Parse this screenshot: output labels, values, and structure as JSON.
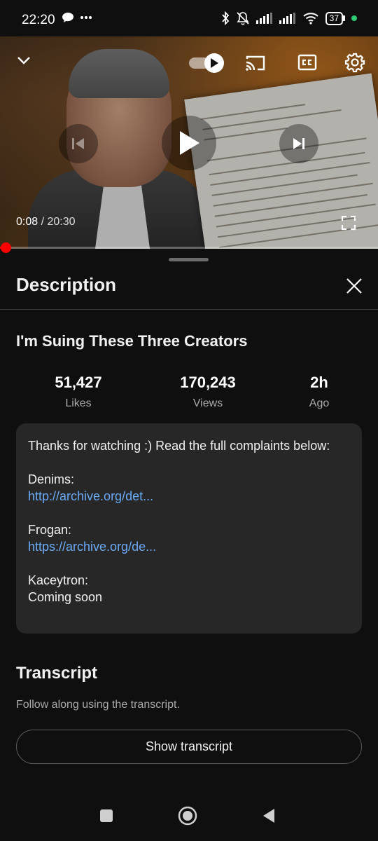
{
  "status_bar": {
    "time": "22:20",
    "left_icons": [
      "chat-bubble-icon",
      "more-dots-icon"
    ],
    "right_icons": [
      "bluetooth-icon",
      "bell-off-icon",
      "signal-icon",
      "signal-icon",
      "wifi-icon"
    ],
    "battery_level": "37",
    "accent_dot_color": "#2ecc71"
  },
  "player": {
    "current_time": "0:08",
    "separator": " / ",
    "duration": "20:30",
    "progress_fraction": 0.0065,
    "progress_color": "#ff0000",
    "controls": [
      "collapse-chevron-icon",
      "autoplay-toggle",
      "cast-icon",
      "captions-icon",
      "settings-gear-icon",
      "previous-icon",
      "play-icon",
      "next-icon",
      "fullscreen-icon"
    ]
  },
  "panel": {
    "title": "Description"
  },
  "video": {
    "title": "I'm Suing These Three Creators",
    "stats": [
      {
        "value": "51,427",
        "label": "Likes"
      },
      {
        "value": "170,243",
        "label": "Views"
      },
      {
        "value": "2h",
        "label": "Ago"
      }
    ]
  },
  "description": {
    "intro": "Thanks for watching :) Read the full complaints below:",
    "entries": [
      {
        "name": "Denims:",
        "link": "http://archive.org/det..."
      },
      {
        "name": "Frogan:",
        "link": "https://archive.org/de..."
      },
      {
        "name": "Kaceytron:",
        "text": "Coming soon"
      }
    ],
    "link_color": "#6aa9f5"
  },
  "transcript": {
    "title": "Transcript",
    "subtitle": "Follow along using the transcript.",
    "button_label": "Show transcript"
  },
  "nav_bar": {
    "icons": [
      "recents-square-icon",
      "home-circle-icon",
      "back-triangle-icon"
    ]
  }
}
